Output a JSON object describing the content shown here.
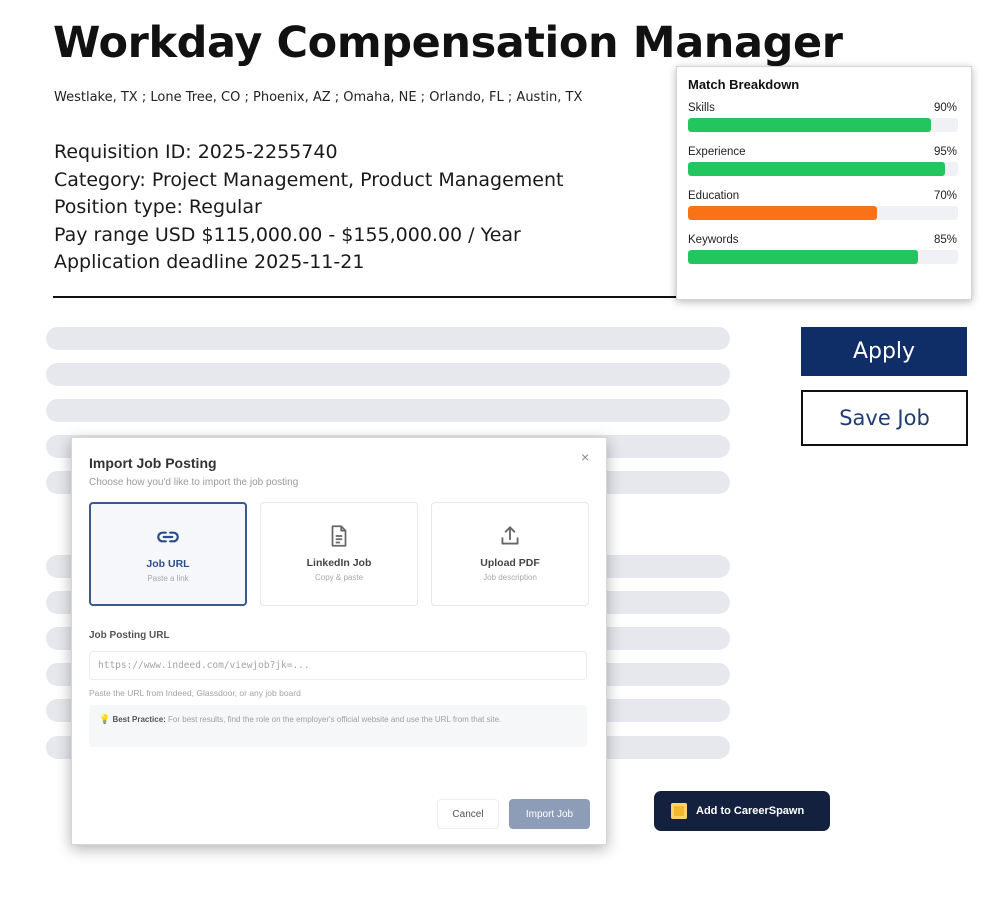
{
  "job": {
    "title": "Workday Compensation Manager",
    "locations": "Westlake, TX ; Lone Tree, CO ; Phoenix, AZ ; Omaha, NE ; Orlando, FL ; Austin, TX",
    "requisition": "Requisition ID: 2025-2255740",
    "category": "Category: Project Management, Product Management",
    "position_type": "Position type: Regular",
    "pay_range": "Pay range USD $115,000.00 - $155,000.00 / Year",
    "deadline": "Application deadline 2025-11-21"
  },
  "actions": {
    "apply_label": "Apply",
    "save_label": "Save Job"
  },
  "match_breakdown": {
    "title": "Match Breakdown",
    "metrics": [
      {
        "label": "Skills",
        "value_text": "90%",
        "value": 90,
        "color": "#22c55e"
      },
      {
        "label": "Experience",
        "value_text": "95%",
        "value": 95,
        "color": "#22c55e"
      },
      {
        "label": "Education",
        "value_text": "70%",
        "value": 70,
        "color": "#f97316"
      },
      {
        "label": "Keywords",
        "value_text": "85%",
        "value": 85,
        "color": "#22c55e"
      }
    ]
  },
  "import_modal": {
    "title": "Import Job Posting",
    "subtitle": "Choose how you'd like to import the job posting",
    "close_symbol": "×",
    "options": [
      {
        "label": "Job URL",
        "desc": "Paste a link",
        "icon": "link-icon",
        "selected": true
      },
      {
        "label": "LinkedIn Job",
        "desc": "Copy & paste",
        "icon": "document-icon",
        "selected": false
      },
      {
        "label": "Upload PDF",
        "desc": "Job description",
        "icon": "upload-icon",
        "selected": false
      }
    ],
    "url_label": "Job Posting URL",
    "url_placeholder": "https://www.indeed.com/viewjob?jk=...",
    "url_value": "",
    "url_help": "Paste the URL from Indeed, Glassdoor, or any job board",
    "tip_icon": "💡",
    "tip_lead": "Best Practice:",
    "tip_text": " For best results, find the role on the employer's official website and use the URL from that site.",
    "cancel_label": "Cancel",
    "import_label": "Import Job",
    "import_enabled": false
  },
  "extension": {
    "button_label": "Add to CareerSpawn",
    "icon": "careerspawn-logo-icon",
    "accent_color": "#f4b82a"
  },
  "colors": {
    "apply_bg": "#0f2d66",
    "skeleton": "#e6e8ee",
    "modal_import_disabled": "#8d9db8"
  }
}
